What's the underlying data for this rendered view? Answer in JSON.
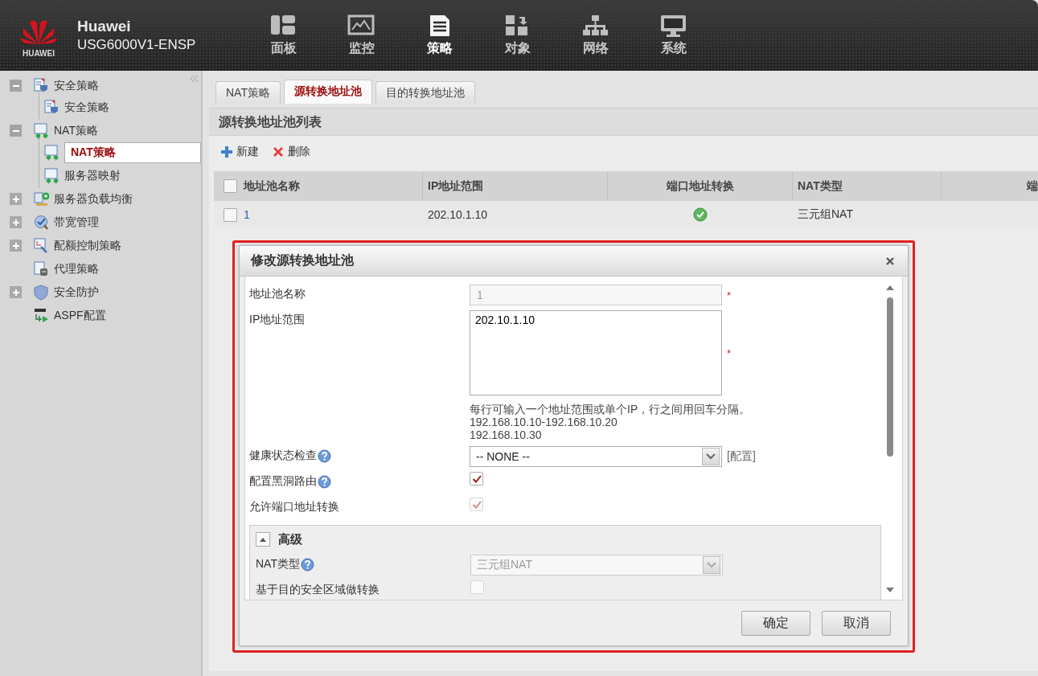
{
  "header": {
    "logo_text": "HUAWEI",
    "brand": "Huawei",
    "device": "USG6000V1-ENSP",
    "nav": [
      {
        "label": "面板",
        "selected": false
      },
      {
        "label": "监控",
        "selected": false
      },
      {
        "label": "策略",
        "selected": true
      },
      {
        "label": "对象",
        "selected": false
      },
      {
        "label": "网络",
        "selected": false
      },
      {
        "label": "系统",
        "selected": false
      }
    ]
  },
  "sidebar": {
    "items": [
      {
        "label": "安全策略",
        "expanded": true,
        "children": [
          {
            "label": "安全策略",
            "selected": false
          }
        ]
      },
      {
        "label": "NAT策略",
        "expanded": true,
        "children": [
          {
            "label": "NAT策略",
            "selected": true
          },
          {
            "label": "服务器映射",
            "selected": false
          }
        ]
      },
      {
        "label": "服务器负载均衡",
        "expanded": false
      },
      {
        "label": "带宽管理",
        "expanded": false
      },
      {
        "label": "配额控制策略",
        "expanded": false
      },
      {
        "label": "代理策略"
      },
      {
        "label": "安全防护",
        "expanded": false
      },
      {
        "label": "ASPF配置"
      }
    ]
  },
  "tabs": [
    {
      "label": "NAT策略",
      "selected": false
    },
    {
      "label": "源转换地址池",
      "selected": true
    },
    {
      "label": "目的转换地址池",
      "selected": false
    }
  ],
  "panel": {
    "title": "源转换地址池列表",
    "toolbar": [
      {
        "label": "新建",
        "kind": "add"
      },
      {
        "label": "删除",
        "kind": "delete"
      }
    ],
    "table": {
      "select_all_checked": false,
      "columns": [
        "地址池名称",
        "IP地址范围",
        "端口地址转换",
        "NAT类型",
        "端"
      ],
      "rows": [
        {
          "checked": false,
          "name": "1",
          "ip_range": "202.10.1.10",
          "port_translation": true,
          "nat_type": "三元组NAT"
        }
      ]
    }
  },
  "dialog": {
    "title": "修改源转换地址池",
    "fields": [
      {
        "kind": "text",
        "label": "地址池名称",
        "value": "1",
        "disabled": true,
        "required_mark": "*"
      },
      {
        "kind": "textarea",
        "label": "IP地址范围",
        "value": "202.10.1.10",
        "required_mark": "*",
        "hint": [
          "每行可输入一个地址范围或单个IP，行之间用回车分隔。",
          "192.168.10.10-192.168.10.20",
          "192.168.10.30"
        ]
      },
      {
        "kind": "select",
        "label": "健康状态检查",
        "value": "-- NONE --",
        "help": true,
        "disabled": false,
        "link": "[配置]"
      },
      {
        "kind": "checkbox",
        "label": "配置黑洞路由",
        "help": true,
        "checked": true,
        "disabled": false
      },
      {
        "kind": "checkbox",
        "label": "允许端口地址转换",
        "checked": true,
        "disabled": true
      }
    ],
    "advanced": {
      "title": "高级",
      "expanded": true,
      "fields": [
        {
          "kind": "select",
          "label": "NAT类型",
          "value": "三元组NAT",
          "help": true,
          "disabled": true
        },
        {
          "kind": "checkbox",
          "label": "基于目的安全区域做转换",
          "checked": false,
          "disabled": true
        }
      ]
    },
    "buttons": [
      "确定",
      "取消"
    ]
  }
}
